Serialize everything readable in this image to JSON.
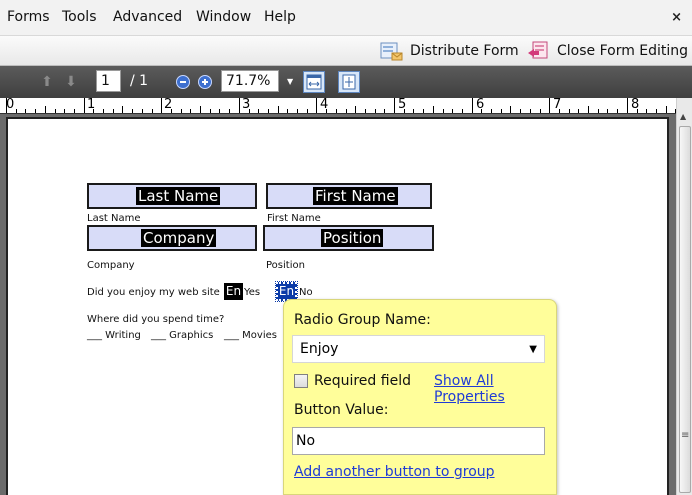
{
  "menubar": {
    "items": [
      "Forms",
      "Tools",
      "Advanced",
      "Window",
      "Help"
    ],
    "close": "×"
  },
  "commandbar": {
    "distribute_label": "Distribute Form",
    "close_editing_label": "Close Form Editing"
  },
  "toolbar": {
    "page_current": "1",
    "page_total": "/ 1",
    "zoom": "71.7%"
  },
  "ruler": {
    "numbers": [
      "0",
      "1",
      "2",
      "3",
      "4",
      "5",
      "6",
      "7",
      "8"
    ]
  },
  "form": {
    "fields": {
      "last_name": "Last Name",
      "first_name": "First Name",
      "company": "Company",
      "position": "Position"
    },
    "captions": {
      "last_name": "Last Name",
      "first_name": "First Name",
      "company": "Company",
      "position": "Position"
    },
    "question_enjoy": "Did you enjoy my web site",
    "radio_yes_short": "En",
    "radio_yes_label": "Yes",
    "radio_no_short": "En",
    "radio_no_label": "No",
    "question_spend": "Where did you spend time?",
    "checks": [
      "___ Writing",
      "___ Graphics",
      "___ Movies"
    ]
  },
  "popup": {
    "group_name_label": "Radio Group Name:",
    "group_name_value": "Enjoy",
    "required_label": "Required field",
    "required_checked": false,
    "show_all_link": "Show All Properties",
    "button_value_label": "Button Value:",
    "button_value": "No",
    "add_button_link": "Add another button to group"
  },
  "colors": {
    "field_fill": "#d8dcf8",
    "popup_bg": "#fffe9a",
    "link": "#1f3bd6",
    "toolbar_dark": "#4a4a4a"
  }
}
